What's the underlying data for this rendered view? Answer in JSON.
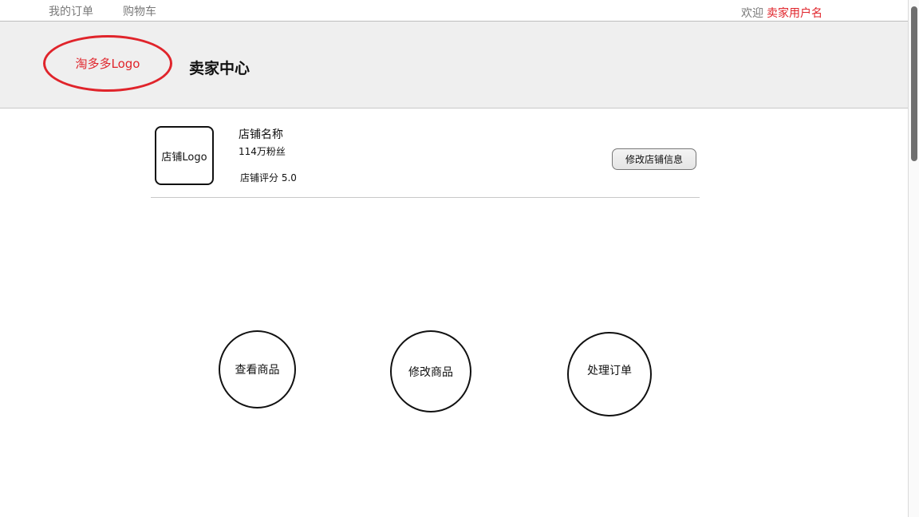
{
  "topbar": {
    "my_orders": "我的订单",
    "cart": "购物车",
    "welcome_label": "欢迎",
    "username": "卖家用户名"
  },
  "header": {
    "logo_text": "淘多多Logo",
    "title": "卖家中心"
  },
  "store": {
    "logo_text": "店铺Logo",
    "name": "店铺名称",
    "fans": "114万粉丝",
    "rating": "店铺评分 5.0",
    "edit_button": "修改店铺信息"
  },
  "actions": {
    "view_products": "查看商品",
    "edit_products": "修改商品",
    "handle_orders": "处理订单"
  },
  "colors": {
    "accent": "#e0242b",
    "header_bg": "#efefef"
  }
}
